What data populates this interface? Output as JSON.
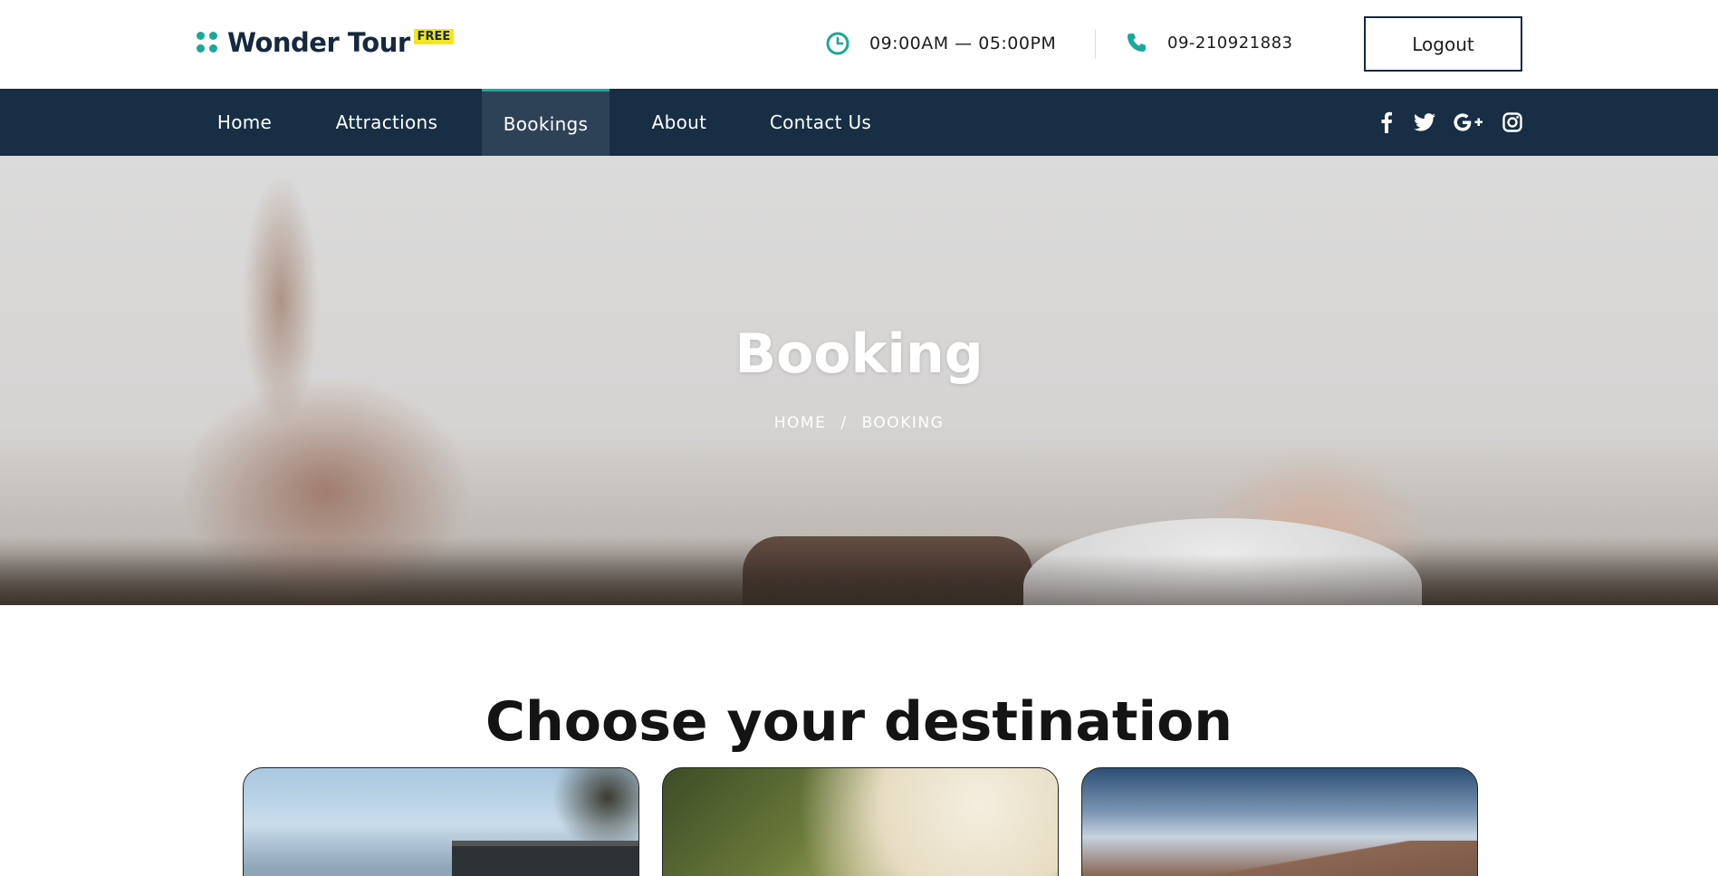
{
  "brand": {
    "name": "Wonder Tour",
    "badge": "FREE",
    "accent": "#1aa89a",
    "navy": "#172e45"
  },
  "header": {
    "hours_icon": "clock-icon",
    "hours": "09:00AM — 05:00PM",
    "phone_icon": "phone-icon",
    "phone": "09-210921883",
    "logout_label": "Logout"
  },
  "nav": {
    "items": [
      {
        "label": "Home",
        "active": false
      },
      {
        "label": "Attractions",
        "active": false
      },
      {
        "label": "Bookings",
        "active": true
      },
      {
        "label": "About",
        "active": false
      },
      {
        "label": "Contact Us",
        "active": false
      }
    ],
    "social": [
      "facebook-icon",
      "twitter-icon",
      "google-plus-icon",
      "instagram-icon"
    ]
  },
  "hero": {
    "title": "Booking",
    "breadcrumb": {
      "home": "HOME",
      "separator": "/",
      "current": "BOOKING"
    }
  },
  "section": {
    "title": "Choose your destination",
    "cards": [
      "destination-card-1",
      "destination-card-2",
      "destination-card-3"
    ]
  }
}
